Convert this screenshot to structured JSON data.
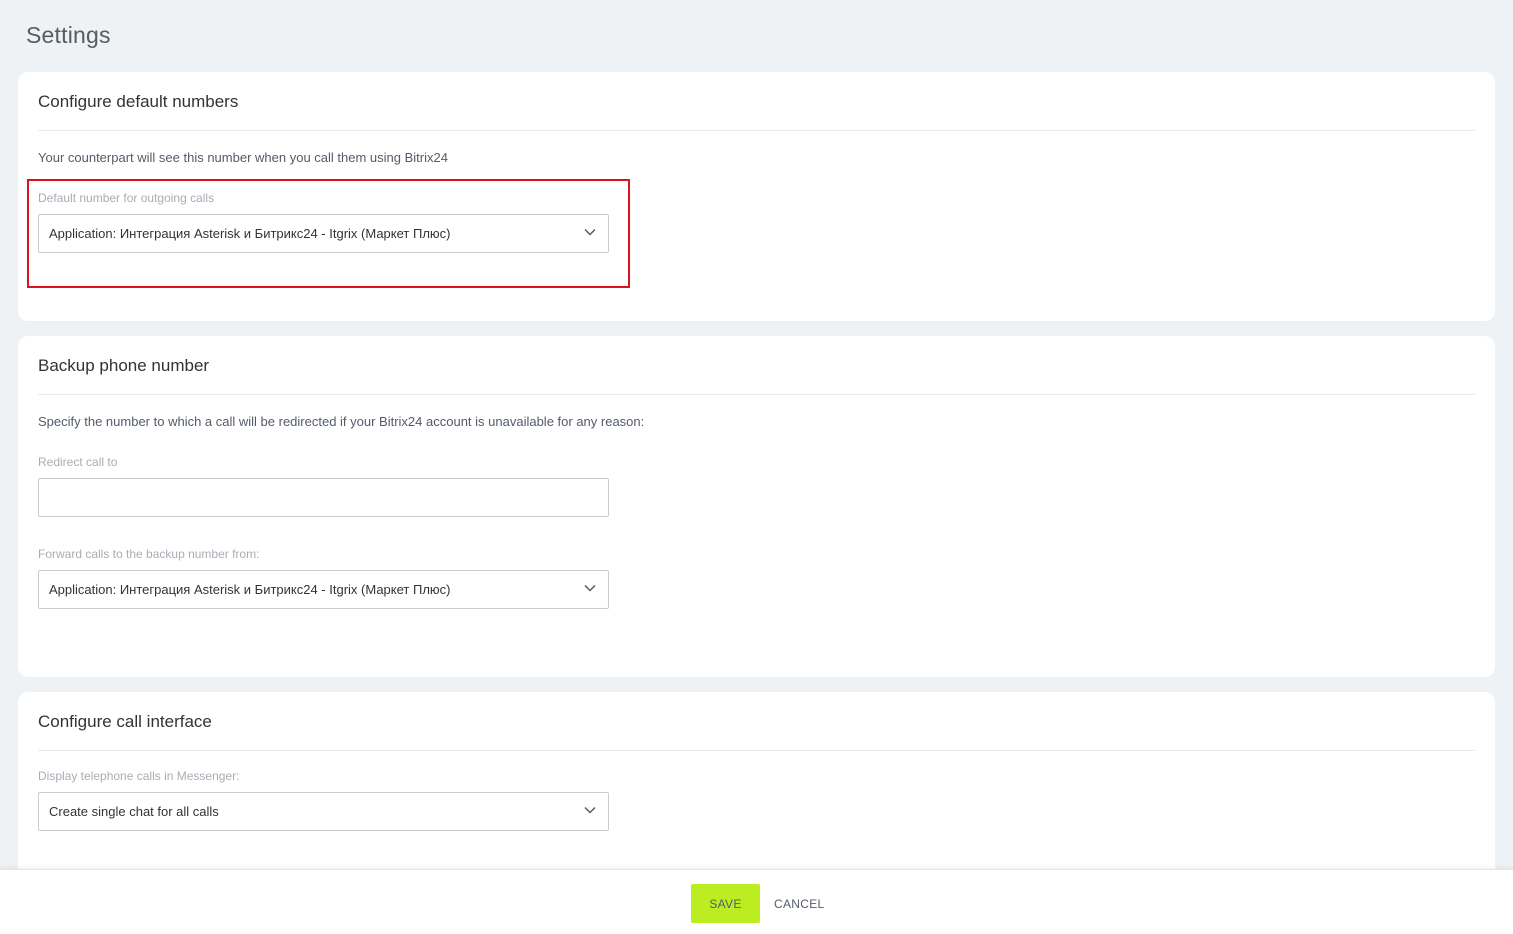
{
  "page": {
    "title": "Settings"
  },
  "sections": {
    "default_numbers": {
      "title": "Configure default numbers",
      "description": "Your counterpart will see this number when you call them using Bitrix24",
      "outgoing_label": "Default number for outgoing calls",
      "outgoing_value": "Application: Интеграция Asterisk и Битрикс24 - Itgrix (Маркет Плюс)"
    },
    "backup": {
      "title": "Backup phone number",
      "description": "Specify the number to which a call will be redirected if your Bitrix24 account is unavailable for any reason:",
      "redirect_label": "Redirect call to",
      "redirect_value": "",
      "forward_label": "Forward calls to the backup number from:",
      "forward_value": "Application: Интеграция Asterisk и Битрикс24 - Itgrix (Маркет Плюс)"
    },
    "call_interface": {
      "title": "Configure call interface",
      "display_label": "Display telephone calls in Messenger:",
      "display_value": "Create single chat for all calls"
    }
  },
  "footer": {
    "save_label": "SAVE",
    "cancel_label": "CANCEL"
  },
  "colors": {
    "background": "#eef2f4",
    "highlight": "#d9141e",
    "save_button": "#bbed21"
  },
  "icons": {
    "select_arrow": "chevron-down-icon"
  }
}
